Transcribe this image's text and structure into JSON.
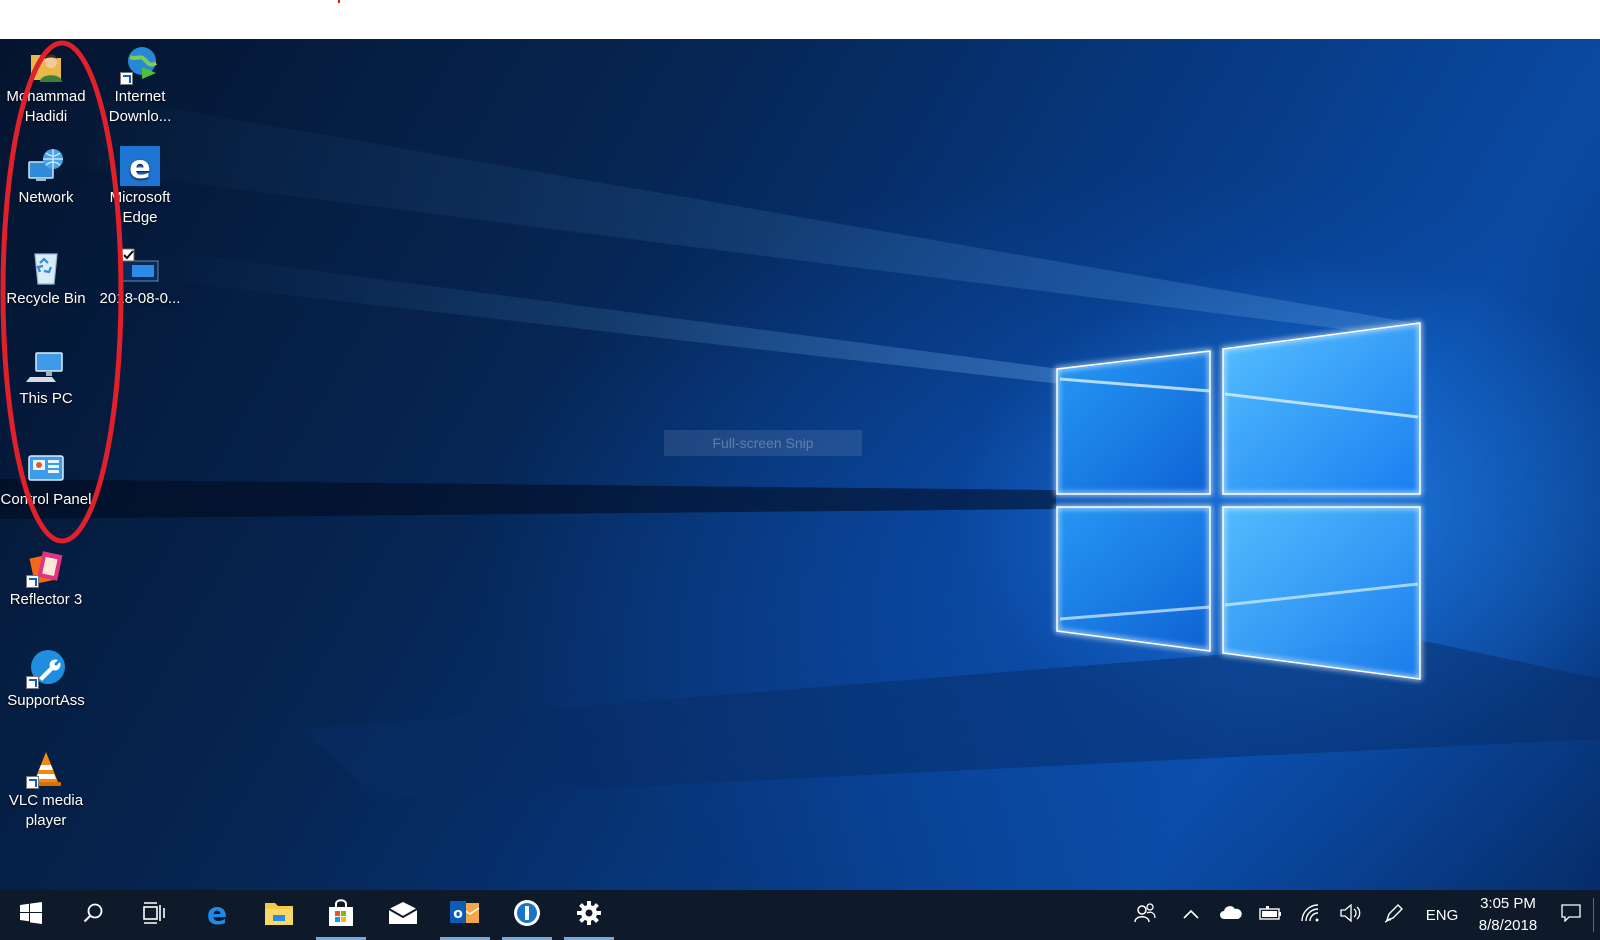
{
  "desktop": {
    "icons": [
      {
        "name": "mohammad-hadidi",
        "icon": "user-folder-icon",
        "label": "Mohammad Hadidi",
        "shortcut": false
      },
      {
        "name": "network",
        "icon": "network-icon",
        "label": "Network",
        "shortcut": false
      },
      {
        "name": "recycle-bin",
        "icon": "recycle-bin-icon",
        "label": "Recycle Bin",
        "shortcut": false
      },
      {
        "name": "this-pc",
        "icon": "computer-icon",
        "label": "This PC",
        "shortcut": false
      },
      {
        "name": "control-panel",
        "icon": "control-panel-icon",
        "label": "Control Panel",
        "shortcut": false
      },
      {
        "name": "reflector-3",
        "icon": "reflector-icon",
        "label": "Reflector 3",
        "shortcut": true
      },
      {
        "name": "supportassist",
        "icon": "wrench-icon",
        "label": "SupportAss",
        "shortcut": true
      },
      {
        "name": "vlc-media-player",
        "icon": "vlc-cone-icon",
        "label": "VLC media player",
        "shortcut": true
      },
      {
        "name": "internet-download-manager",
        "icon": "idm-globe-icon",
        "label": "Internet Downlo...",
        "shortcut": true
      },
      {
        "name": "microsoft-edge",
        "icon": "edge-icon",
        "label": "Microsoft Edge",
        "shortcut": false
      },
      {
        "name": "screenshot-file",
        "icon": "image-file-icon",
        "label": "2018-08-0...",
        "shortcut": false
      }
    ],
    "snip_label": "Full-screen Snip",
    "highlight_color": "#e0202a"
  },
  "taskbar": {
    "buttons": [
      {
        "name": "start-button",
        "icon": "windows-logo-icon",
        "running": false
      },
      {
        "name": "search-button",
        "icon": "search-icon",
        "running": false
      },
      {
        "name": "task-view-button",
        "icon": "task-view-icon",
        "running": false
      },
      {
        "name": "taskbar-edge",
        "icon": "edge-icon",
        "running": false
      },
      {
        "name": "taskbar-file-explorer",
        "icon": "folder-icon",
        "running": false
      },
      {
        "name": "taskbar-store",
        "icon": "store-bag-icon",
        "running": true
      },
      {
        "name": "taskbar-mail",
        "icon": "mail-icon",
        "running": false
      },
      {
        "name": "taskbar-outlook",
        "icon": "outlook-icon",
        "running": true
      },
      {
        "name": "taskbar-1password",
        "icon": "keyhole-icon",
        "running": true
      },
      {
        "name": "taskbar-settings",
        "icon": "gear-icon",
        "running": true
      }
    ],
    "tray": {
      "people_icon": "people-icon",
      "overflow_icon": "chevron-up-icon",
      "onedrive_icon": "cloud-icon",
      "battery_icon": "battery-icon",
      "wifi_icon": "wifi-icon",
      "volume_icon": "speaker-icon",
      "pen_icon": "pen-icon",
      "language": "ENG",
      "time": "3:05 PM",
      "date": "8/8/2018",
      "notifications_icon": "action-center-icon"
    },
    "colors": {
      "background": "#0e1a2a",
      "running_indicator": "#79a8df"
    }
  }
}
